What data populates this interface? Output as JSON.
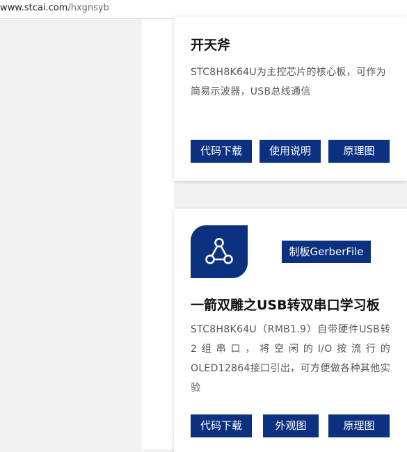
{
  "address_bar": {
    "host": "www.stcai.com",
    "path": "/hxgnsyb"
  },
  "cards": [
    {
      "title": "开天斧",
      "description": "STC8H8K64U为主控芯片的核心板，可作为简易示波器，USB总线通信",
      "buttons": [
        {
          "label": "代码下载"
        },
        {
          "label": "使用说明"
        },
        {
          "label": "原理图"
        }
      ]
    },
    {
      "logo_icon": "share-nodes-icon",
      "gerber_button_label": "制板GerberFile",
      "title": "一箭双雕之USB转双串口学习板",
      "description": "STC8H8K64U（RMB1.9）自带硬件USB转2组串口，将空闲的I/O按流行的 OLED12864接口引出，可方便做各种其他实验",
      "buttons": [
        {
          "label": "代码下载"
        },
        {
          "label": "外观图"
        },
        {
          "label": "原理图"
        }
      ]
    }
  ],
  "colors": {
    "brand_blue": "#0c3181",
    "page_background": "#f2f2f2",
    "card_background": "#ffffff",
    "title_text": "#111111",
    "body_text": "#555555"
  }
}
